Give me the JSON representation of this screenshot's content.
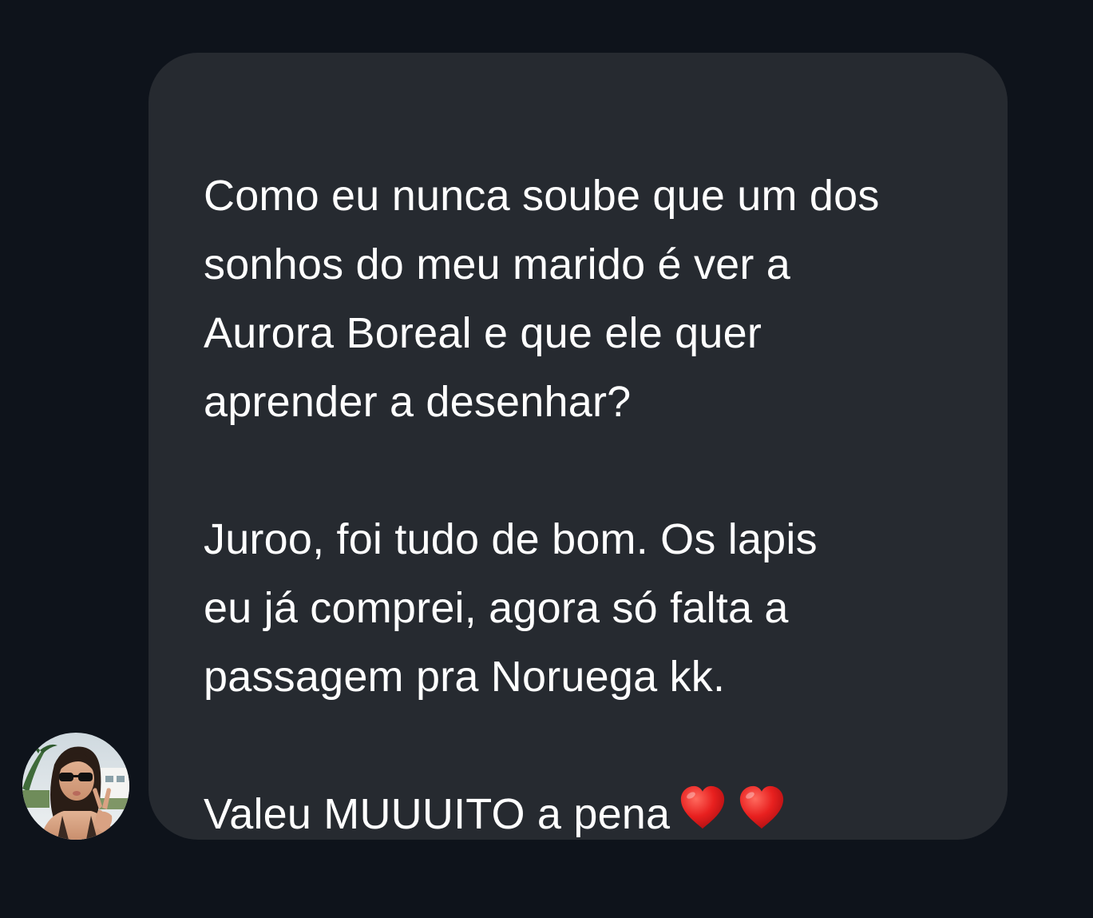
{
  "conversation": {
    "message": {
      "paragraphs": [
        {
          "lines": [
            "Como eu nunca soube que um dos",
            "sonhos do meu marido é ver a",
            "Aurora Boreal e que ele quer",
            "aprender a desenhar?"
          ]
        },
        {
          "lines": [
            "Juroo, foi tudo de bom. Os lapis",
            "eu já comprei, agora só falta a",
            "passagem pra Noruega kk."
          ]
        },
        {
          "lines": [
            "Valeu MUUUITO a pena"
          ]
        }
      ],
      "emojis": [
        "red-heart-icon",
        "red-heart-icon"
      ]
    },
    "sender_avatar": "profile-photo"
  },
  "colors": {
    "background": "#0e131b",
    "bubble": "#262a30",
    "text": "#ffffff",
    "heart": "#e8201f"
  }
}
